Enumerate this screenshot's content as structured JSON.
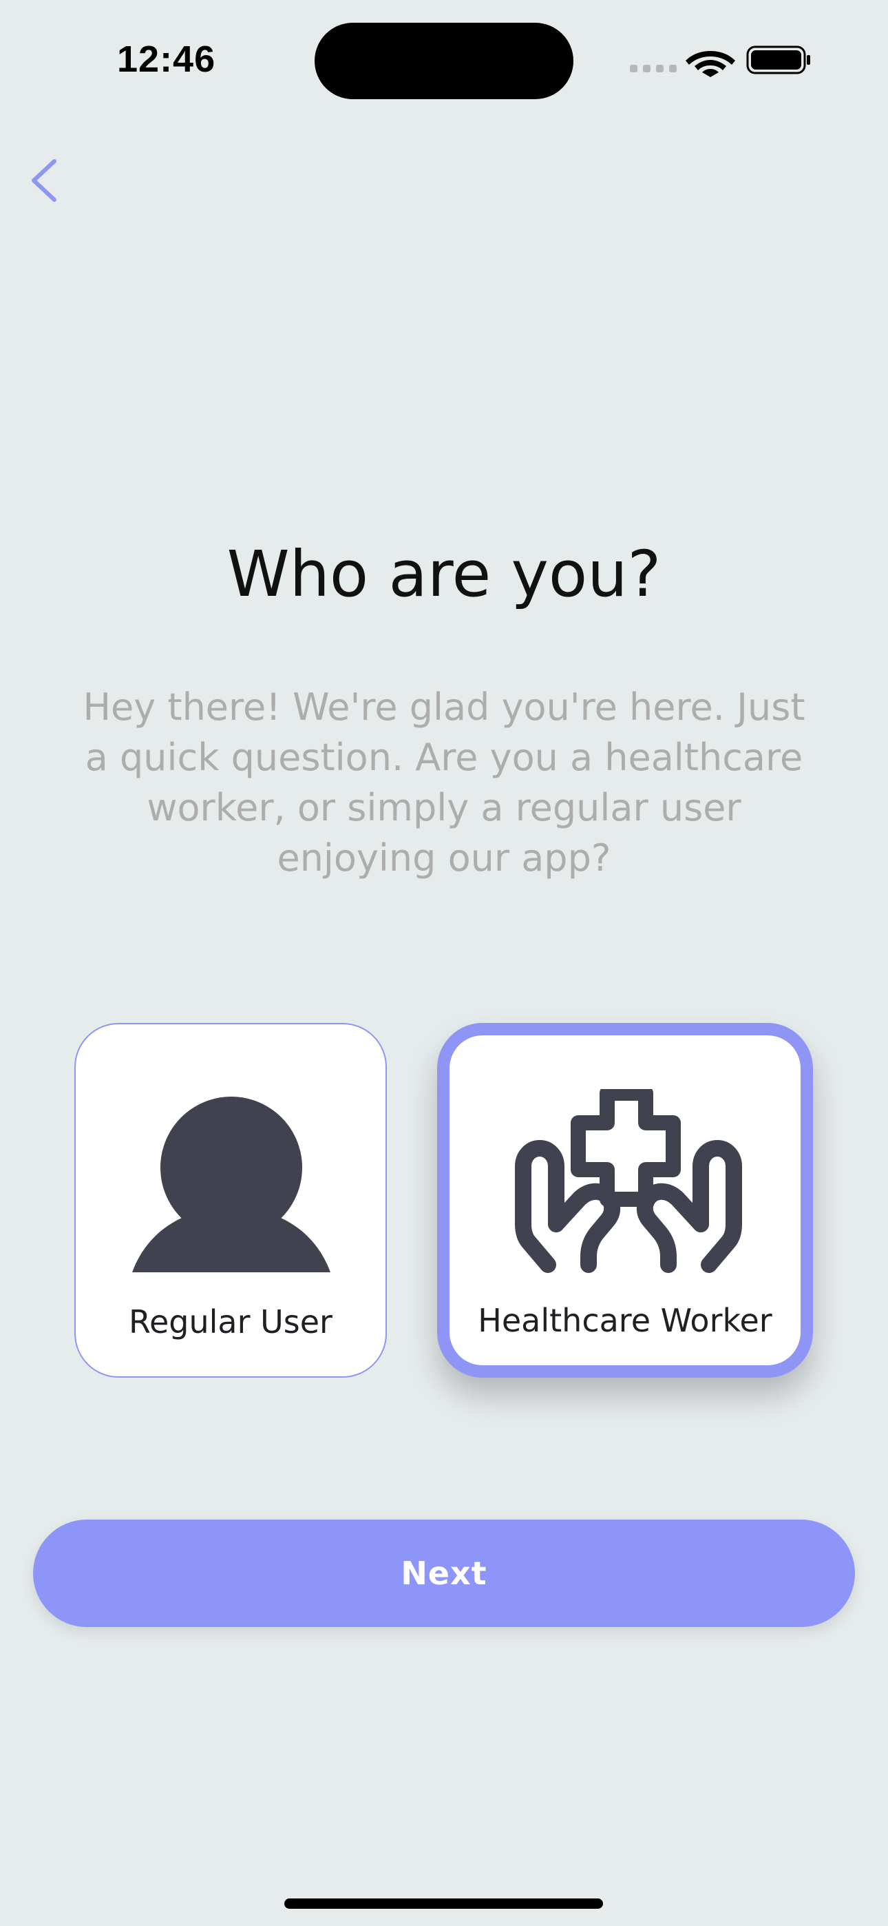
{
  "status_bar": {
    "time": "12:46",
    "icons": [
      "signal-icon",
      "wifi-icon",
      "battery-icon"
    ]
  },
  "nav": {
    "back_icon": "chevron-left-icon"
  },
  "title": "Who are you?",
  "subtitle": "Hey there! We're glad you're here. Just a quick question. Are you a healthcare worker, or simply a regular user enjoying our app?",
  "roles": [
    {
      "label": "Regular User",
      "icon": "person-icon",
      "selected": false
    },
    {
      "label": "Healthcare Worker",
      "icon": "hands-medical-cross-icon",
      "selected": true
    }
  ],
  "next_button": {
    "label": "Next"
  },
  "colors": {
    "background": "#e6ebec",
    "accent": "#8e95f9",
    "icon": "#41424f",
    "subtitle": "#adadad"
  }
}
